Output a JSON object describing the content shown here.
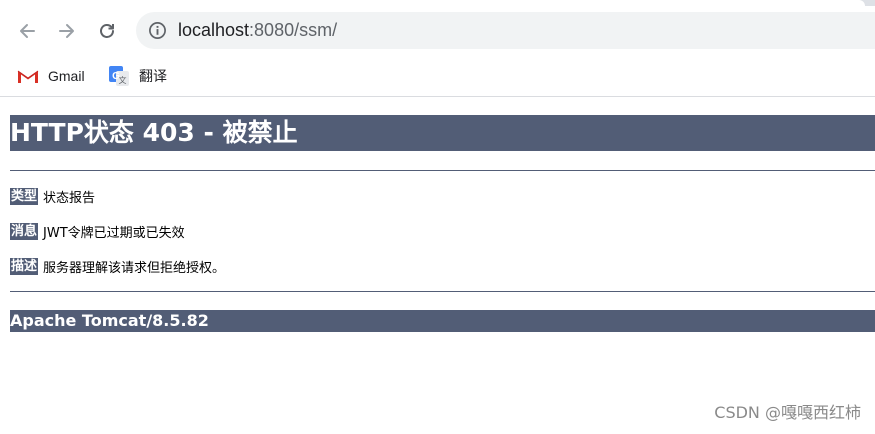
{
  "browser": {
    "address": {
      "host": "localhost",
      "rest": ":8080/ssm/"
    },
    "bookmarks": [
      {
        "label": "Gmail",
        "icon": "gmail-icon"
      },
      {
        "label": "翻译",
        "icon": "translate-icon"
      }
    ]
  },
  "page": {
    "title": "HTTP状态 403 - 被禁止",
    "type_label": "类型",
    "type_value": "状态报告",
    "message_label": "消息",
    "message_value": "JWT令牌已过期或已失效",
    "description_label": "描述",
    "description_value": "服务器理解该请求但拒绝授权。",
    "footer": "Apache Tomcat/8.5.82"
  },
  "watermark": "CSDN @嘎嘎西红柿",
  "colors": {
    "accent": "#525d76"
  }
}
